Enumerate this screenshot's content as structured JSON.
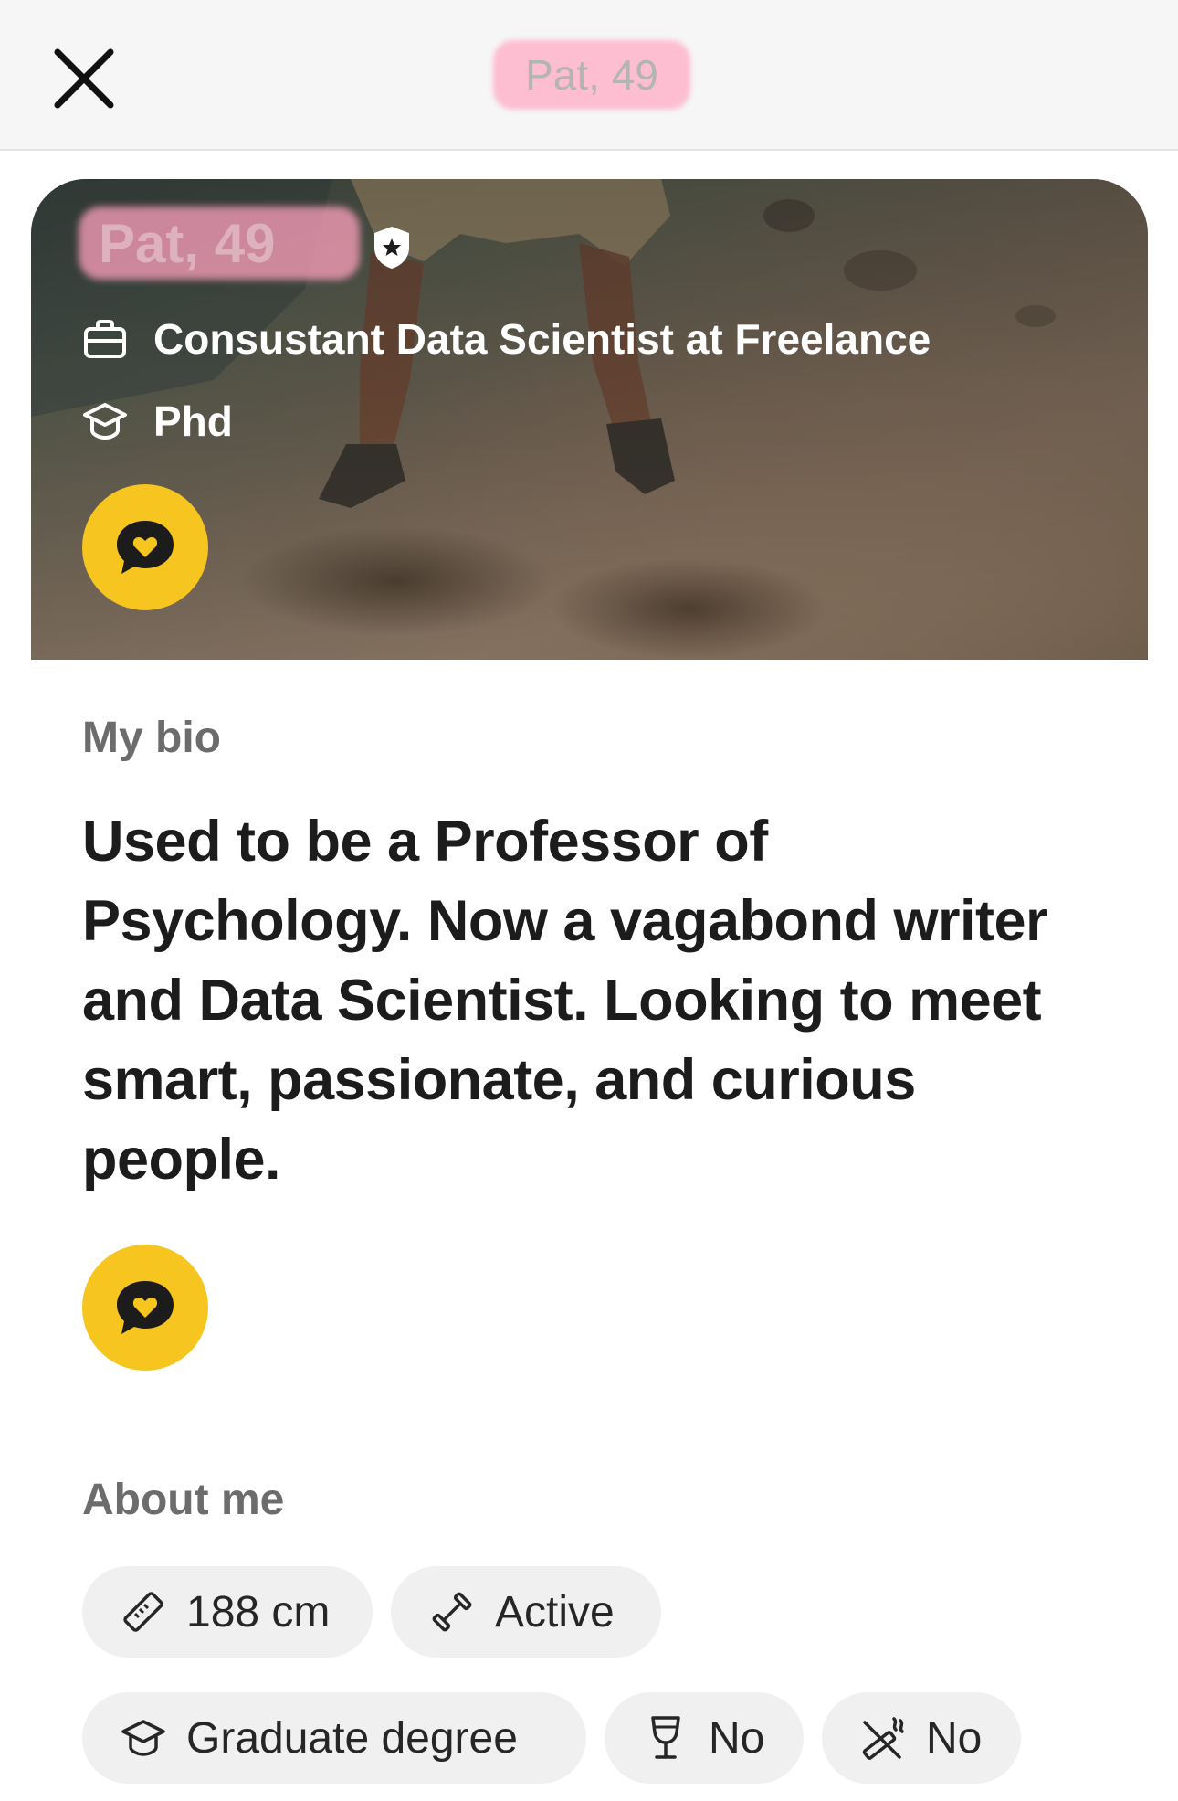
{
  "header": {
    "name_age": "Pat, 49",
    "close_icon": "close-icon"
  },
  "hero": {
    "name_age": "Pat, 49",
    "verified_icon": "verified-shield-icon",
    "job": "Consustant Data Scientist at Freelance",
    "job_icon": "briefcase-icon",
    "education": "Phd",
    "education_icon": "graduation-cap-icon",
    "chat_icon": "chat-heart-icon"
  },
  "bio": {
    "label": "My bio",
    "text": "Used to be a Professor of Psychology. Now a vagabond writer and Data Scientist. Looking to meet smart, passionate, and curious people.",
    "chat_icon": "chat-heart-icon"
  },
  "about": {
    "label": "About me",
    "chips": [
      {
        "icon": "ruler-icon",
        "label": "188 cm"
      },
      {
        "icon": "dumbbell-icon",
        "label": "Active"
      },
      {
        "icon": "graduation-cap-icon",
        "label": "Graduate degree"
      },
      {
        "icon": "wine-glass-icon",
        "label": "No"
      },
      {
        "icon": "cigarette-icon",
        "label": "No"
      }
    ]
  },
  "colors": {
    "accent": "#f7c51f",
    "chip_bg": "#f0f0f0",
    "label_gray": "#6c6c6c",
    "redaction_pink": "#ffa8c4"
  }
}
